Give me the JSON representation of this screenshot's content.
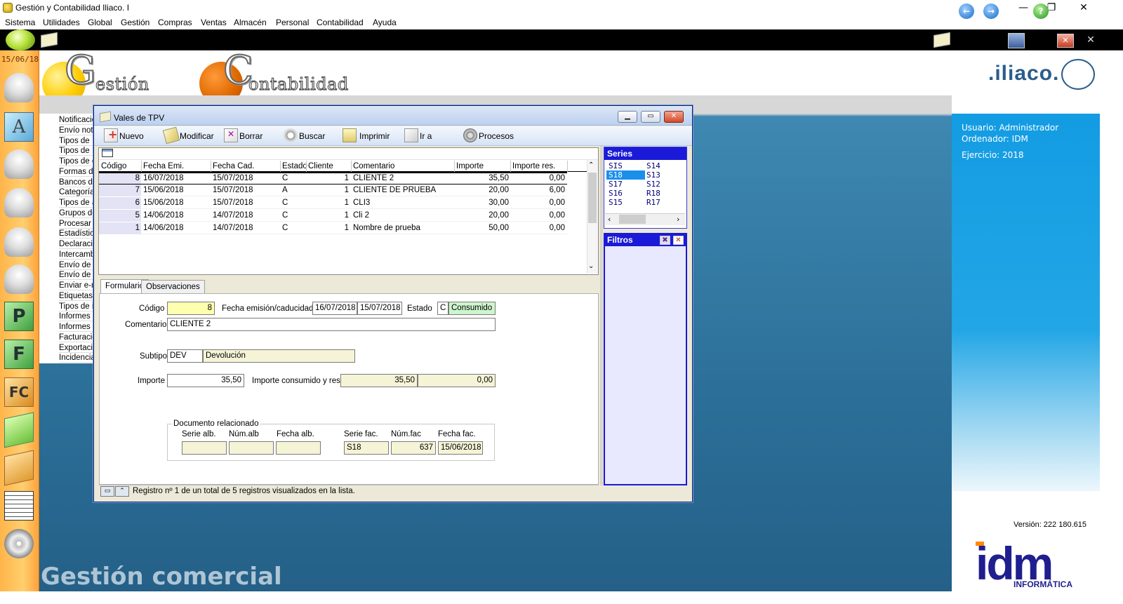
{
  "window": {
    "title": "Gestión y Contabilidad Iliaco. I",
    "controls": {
      "minimize": "—",
      "maximize": "❐",
      "close": "✕"
    }
  },
  "menu": [
    "Sistema",
    "Utilidades",
    "Global",
    "Gestión",
    "Compras",
    "Ventas",
    "Almacén",
    "Personal",
    "Contabilidad",
    "Ayuda"
  ],
  "sidebar": {
    "date": "15/06/18"
  },
  "header": {
    "logo1_initial": "G",
    "logo1_rest": "estión",
    "logo2_initial": "C",
    "logo2_rest": "ontabilidad",
    "brand": ".iliaco."
  },
  "tree_items": [
    "Notificacio",
    "Envío noti",
    "Tipos de I",
    "Tipos de II",
    "Tipos de e",
    "Formas de",
    "Bancos de",
    "Categoría",
    "Tipos de a",
    "Grupos de",
    "Procesar f",
    "Estadística",
    "Declaracio",
    "Intercambi",
    "Envío de I",
    "Envío de",
    "Enviar e-m",
    "Etiquetas",
    "Tipos de ir",
    "Informes d",
    "Informes d",
    "Facturació",
    "Exportació",
    "Incidencia"
  ],
  "footer_text": "Gestión comercial",
  "info": {
    "usuario": "Usuario: Administrador",
    "ordenador": "Ordenador: IDM",
    "ejercicio": "Ejercicio: 2018",
    "version": "Versión: 222 180.615",
    "idm": "idm",
    "idm_sub": "INFORMÁTICA"
  },
  "dialog": {
    "title": "Vales de TPV",
    "toolbar": {
      "nuevo": "Nuevo",
      "modificar": "Modificar",
      "borrar": "Borrar",
      "buscar": "Buscar",
      "imprimir": "Imprimir",
      "ir_a": "Ir a",
      "procesos": "Procesos"
    },
    "columns": [
      "Código",
      "Fecha Emi.",
      "Fecha Cad.",
      "Estado",
      "Cliente",
      "Comentario",
      "Importe",
      "Importe res."
    ],
    "rows": [
      {
        "codigo": "8",
        "fecha_emi": "16/07/2018",
        "fecha_cad": "15/07/2018",
        "estado": "C",
        "cliente": "1",
        "comentario": "CLIENTE 2",
        "importe": "35,50",
        "importe_res": "0,00"
      },
      {
        "codigo": "7",
        "fecha_emi": "15/06/2018",
        "fecha_cad": "15/07/2018",
        "estado": "A",
        "cliente": "1",
        "comentario": "CLIENTE DE PRUEBA",
        "importe": "20,00",
        "importe_res": "6,00"
      },
      {
        "codigo": "6",
        "fecha_emi": "15/06/2018",
        "fecha_cad": "15/07/2018",
        "estado": "C",
        "cliente": "1",
        "comentario": "CLI3",
        "importe": "30,00",
        "importe_res": "0,00"
      },
      {
        "codigo": "5",
        "fecha_emi": "14/06/2018",
        "fecha_cad": "14/07/2018",
        "estado": "C",
        "cliente": "1",
        "comentario": "Cli 2",
        "importe": "20,00",
        "importe_res": "0,00"
      },
      {
        "codigo": "1",
        "fecha_emi": "14/06/2018",
        "fecha_cad": "14/07/2018",
        "estado": "C",
        "cliente": "1",
        "comentario": "Nombre de prueba",
        "importe": "50,00",
        "importe_res": "0,00"
      }
    ],
    "tabs": [
      "Formulario",
      "Observaciones"
    ],
    "form": {
      "codigo_label": "Código",
      "codigo": "8",
      "fechas_label": "Fecha emisión/caducidad",
      "fecha_emision": "16/07/2018",
      "fecha_caducidad": "15/07/2018",
      "estado_label": "Estado",
      "estado_code": "C",
      "estado_text": "Consumido",
      "comentario_label": "Comentario",
      "comentario": "CLIENTE 2",
      "subtipo_label": "Subtipo",
      "subtipo_code": "DEV",
      "subtipo_text": "Devolución",
      "importe_label": "Importe",
      "importe": "35,50",
      "consumido_label": "Importe consumido y rest.",
      "consumido": "35,50",
      "restante": "0,00",
      "docrel_title": "Documento relacionado",
      "serie_alb_label": "Serie alb.",
      "num_alb_label": "Núm.alb",
      "fecha_alb_label": "Fecha alb.",
      "serie_fac_label": "Serie fac.",
      "num_fac_label": "Núm.fac",
      "fecha_fac_label": "Fecha fac.",
      "serie_fac": "S18",
      "num_fac": "637",
      "fecha_fac": "15/06/2018"
    },
    "status": "Registro nº 1 de un total de 5 registros visualizados en la lista.",
    "series": {
      "title": "Series",
      "col1": [
        "SIS",
        "S18",
        "S17",
        "S16",
        "S15"
      ],
      "col2": [
        "S14",
        "S13",
        "S12",
        "R18",
        "R17"
      ],
      "selected": "S18"
    },
    "filters": {
      "title": "Filtros"
    }
  }
}
